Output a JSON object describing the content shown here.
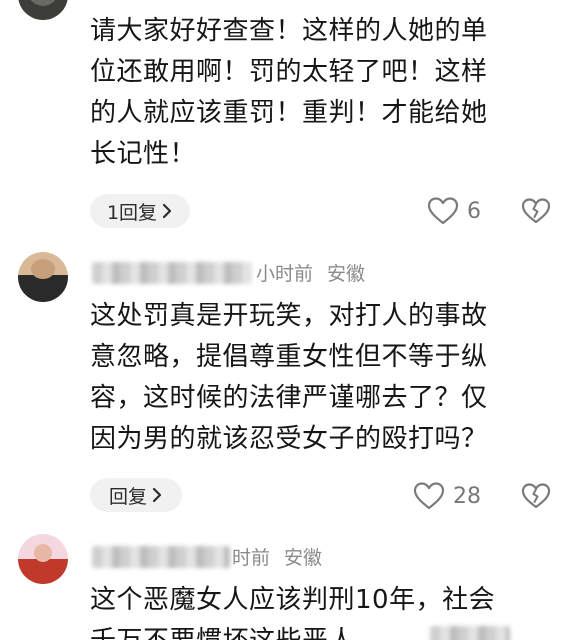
{
  "comments": [
    {
      "lines": [
        "请大家好好查查！这样的人她的单",
        "位还敢用啊！罚的太轻了吧！这样",
        "的人就应该重罚！重判！才能给她",
        "长记性！"
      ],
      "reply_label": "1回复",
      "like_count": "6"
    },
    {
      "time": "小时前",
      "location": "安徽",
      "lines": [
        "这处罚真是开玩笑，对打人的事故",
        "意忽略，提倡尊重女性但不等于纵",
        "容，这时候的法律严谨哪去了？仅",
        "因为男的就该忍受女子的殴打吗？"
      ],
      "reply_label": "回复",
      "like_count": "28"
    },
    {
      "time": "时前",
      "location": "安徽",
      "lines": [
        "这个恶魔女人应该判刑10年，社会",
        "千万不要惯坏这些恶人"
      ]
    }
  ],
  "icons": {
    "chevron": "chevron-right-icon",
    "like": "heart-outline-icon",
    "dislike": "broken-heart-icon"
  }
}
